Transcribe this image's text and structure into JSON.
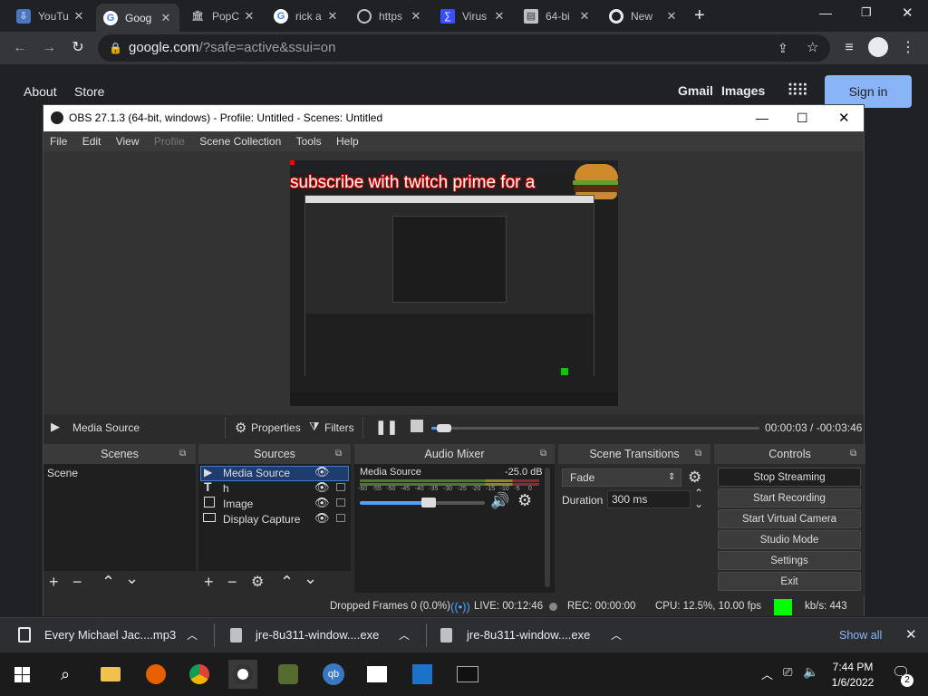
{
  "browser": {
    "tabs": [
      {
        "label": "YouTu",
        "active": false
      },
      {
        "label": "Goog",
        "active": true
      },
      {
        "label": "PopC",
        "active": false
      },
      {
        "label": "rick a",
        "active": false
      },
      {
        "label": "https",
        "active": false
      },
      {
        "label": "Virus",
        "active": false
      },
      {
        "label": "64-bi",
        "active": false
      },
      {
        "label": "New",
        "active": false
      }
    ],
    "url_host": "google.com",
    "url_rest": "/?safe=active&ssui=on"
  },
  "google": {
    "about": "About",
    "store": "Store",
    "gmail": "Gmail",
    "images": "Images",
    "sign_in": "Sign in"
  },
  "obs": {
    "title": "OBS 27.1.3 (64-bit, windows) - Profile: Untitled - Scenes: Untitled",
    "menu": [
      "File",
      "Edit",
      "View",
      "Profile",
      "Scene Collection",
      "Tools",
      "Help"
    ],
    "preview_caption": "subscribe with twitch prime for a",
    "source_bar": {
      "source_name": "Media Source",
      "properties": "Properties",
      "filters": "Filters",
      "time": "00:00:03 / -00:03:46",
      "progress": 0.04
    },
    "docks": {
      "scenes": {
        "title": "Scenes",
        "items": [
          "Scene"
        ]
      },
      "sources": {
        "title": "Sources",
        "items": [
          "Media Source",
          "h",
          "Image",
          "Display Capture"
        ]
      },
      "audio": {
        "title": "Audio Mixer",
        "source": "Media Source",
        "level": "-25.0 dB",
        "ticks": [
          "-60",
          "-55",
          "-50",
          "-45",
          "-40",
          "-35",
          "-30",
          "-25",
          "-20",
          "-15",
          "-10",
          "-5",
          "0"
        ],
        "volume": 0.55
      },
      "transitions": {
        "title": "Scene Transitions",
        "type": "Fade",
        "duration_label": "Duration",
        "duration": "300 ms"
      },
      "controls": {
        "title": "Controls",
        "buttons": [
          "Stop Streaming",
          "Start Recording",
          "Start Virtual Camera",
          "Studio Mode",
          "Settings",
          "Exit"
        ]
      }
    },
    "status": {
      "dropped": "Dropped Frames 0 (0.0%)",
      "live": "LIVE: 00:12:46",
      "rec": "REC: 00:00:00",
      "cpu": "CPU: 12.5%, 10.00 fps",
      "kbs": "kb/s: 443"
    }
  },
  "downloads": {
    "items": [
      "Every Michael Jac....mp3",
      "jre-8u311-window....exe",
      "jre-8u311-window....exe"
    ],
    "show_all": "Show all"
  },
  "taskbar": {
    "time": "7:44 PM",
    "date": "1/6/2022",
    "notif_count": "2"
  }
}
